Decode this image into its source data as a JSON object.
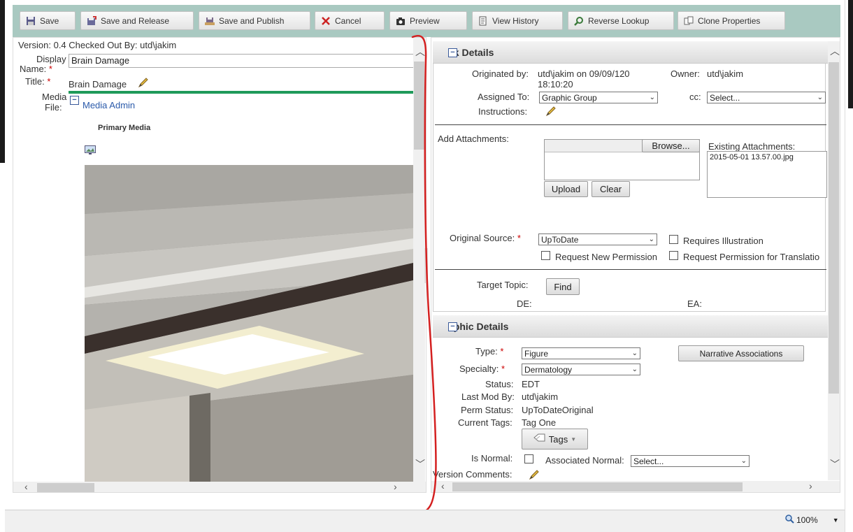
{
  "toolbar": {
    "save": "Save",
    "save_release": "Save and Release",
    "save_publish": "Save and Publish",
    "cancel": "Cancel",
    "preview": "Preview",
    "view_history": "View History",
    "reverse_lookup": "Reverse Lookup",
    "clone_properties": "Clone Properties"
  },
  "left": {
    "version_line": "Version:  0.4  Checked Out By:  utd\\jakim",
    "display_name_label": "Display",
    "display_name_label2": "Name:",
    "display_name_value": "Brain Damage",
    "title_label": "Title:",
    "title_value": "Brain Damage",
    "media_label": "Media",
    "media_label2": "File:",
    "media_admin_link": "Media Admin",
    "primary_media": "Primary Media"
  },
  "task": {
    "header": "sk Details",
    "originated_label": "Originated by:",
    "originated_value": "utd\\jakim on 09/09/120",
    "originated_time": "18:10:20",
    "owner_label": "Owner:",
    "owner_value": "utd\\jakim",
    "assigned_label": "Assigned To:",
    "assigned_value": "Graphic Group",
    "cc_label": "cc:",
    "cc_value": "Select...",
    "instructions_label": "Instructions:",
    "add_attachments_label": "Add Attachments:",
    "browse": "Browse...",
    "upload": "Upload",
    "clear": "Clear",
    "existing_attachments_label": "Existing Attachments:",
    "existing_attachment_file": "2015-05-01 13.57.00.jpg",
    "original_source_label": "Original Source:",
    "original_source_value": "UpToDate",
    "requires_illustration": "Requires Illustration",
    "request_new_permission": "Request New Permission",
    "request_permission_translation": "Request Permission for Translatio",
    "target_topic_label": "Target Topic:",
    "find": "Find",
    "de_label": "DE:",
    "ea_label": "EA:"
  },
  "graphic": {
    "header": "aphic Details",
    "type_label": "Type:",
    "type_value": "Figure",
    "narrative_button": "Narrative Associations",
    "specialty_label": "Specialty:",
    "specialty_value": "Dermatology",
    "status_label": "Status:",
    "status_value": "EDT",
    "last_mod_label": "Last Mod By:",
    "last_mod_value": "utd\\jakim",
    "perm_status_label": "Perm Status:",
    "perm_status_value": "UpToDateOriginal",
    "current_tags_label": "Current Tags:",
    "current_tags_value": "Tag One",
    "tags_button": "Tags",
    "is_normal_label": "Is Normal:",
    "associated_normal_label": "Associated Normal:",
    "associated_normal_value": "Select...",
    "version_comments_label": "Version Comments:"
  },
  "required_marker": "*",
  "status_bar": {
    "zoom": "100%"
  }
}
